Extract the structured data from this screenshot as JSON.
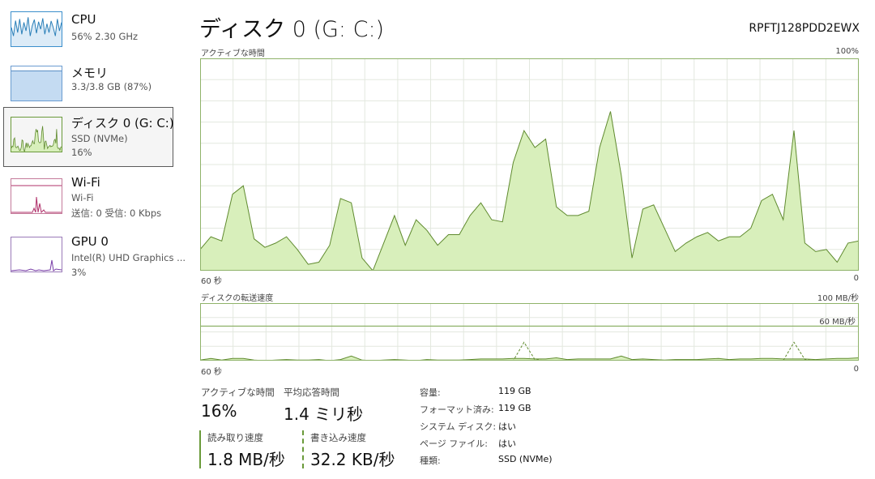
{
  "sidebar": {
    "items": [
      {
        "title": "CPU",
        "sub1": "56%  2.30 GHz",
        "sub2": ""
      },
      {
        "title": "メモリ",
        "sub1": "3.3/3.8 GB (87%)",
        "sub2": ""
      },
      {
        "title": "ディスク 0 (G: C:)",
        "sub1": "SSD (NVMe)",
        "sub2": "16%"
      },
      {
        "title": "Wi-Fi",
        "sub1": "Wi-Fi",
        "sub2": "送信: 0  受信: 0 Kbps"
      },
      {
        "title": "GPU 0",
        "sub1": "Intel(R) UHD Graphics ...",
        "sub2": "3%"
      }
    ]
  },
  "header": {
    "title": "ディスク 0 (G: C:)",
    "model": "RPFTJ128PDD2EWX"
  },
  "graph1": {
    "label": "アクティブな時間",
    "max_label": "100%",
    "left_axis": "60 秒",
    "right_axis": "0"
  },
  "graph2": {
    "label": "ディスクの転送速度",
    "max_label": "100 MB/秒",
    "line_label": "60 MB/秒",
    "left_axis": "60 秒",
    "right_axis": "0"
  },
  "stats": {
    "active_label": "アクティブな時間",
    "active_value": "16%",
    "resp_label": "平均応答時間",
    "resp_value": "1.4 ミリ秒",
    "read_label": "読み取り速度",
    "read_value": "1.8 MB/秒",
    "write_label": "書き込み速度",
    "write_value": "32.2 KB/秒"
  },
  "info": [
    {
      "key": "容量:",
      "value": "119 GB"
    },
    {
      "key": "フォーマット済み:",
      "value": "119 GB"
    },
    {
      "key": "システム ディスク:",
      "value": "はい"
    },
    {
      "key": "ページ ファイル:",
      "value": "はい"
    },
    {
      "key": "種類:",
      "value": "SSD (NVMe)"
    }
  ],
  "colors": {
    "disk_fill": "#d8efbb",
    "disk_line": "#5f8a2e",
    "cpu_line": "#2a7fb8",
    "mem_fill": "#c4dbf2",
    "wifi_line": "#b0306a",
    "gpu_line": "#7a3fa8",
    "grid": "#e3e8df"
  },
  "chart_data": {
    "active_time_percent": [
      10,
      16,
      14,
      36,
      40,
      15,
      11,
      13,
      16,
      10,
      3,
      4,
      12,
      34,
      32,
      6,
      0,
      13,
      26,
      12,
      24,
      19,
      12,
      17,
      17,
      26,
      32,
      24,
      23,
      51,
      66,
      58,
      62,
      30,
      26,
      26,
      28,
      58,
      75,
      45,
      6,
      29,
      31,
      20,
      9,
      13,
      16,
      18,
      14,
      16,
      16,
      20,
      33,
      36,
      24,
      66,
      13,
      9,
      10,
      4,
      13,
      14
    ],
    "transfer_read": [
      1,
      4,
      1,
      4,
      4,
      1,
      0,
      1,
      2,
      1,
      1,
      2,
      0,
      2,
      8,
      1,
      0,
      1,
      2,
      1,
      0,
      2,
      1,
      1,
      1,
      2,
      3,
      3,
      3,
      4,
      4,
      3,
      3,
      5,
      2,
      3,
      3,
      3,
      3,
      8,
      2,
      3,
      2,
      1,
      2,
      2,
      2,
      3,
      4,
      2,
      3,
      3,
      4,
      4,
      3,
      3,
      3,
      2,
      3,
      4,
      4,
      5
    ],
    "transfer_write": [
      0,
      0,
      0,
      0,
      0,
      0,
      0,
      0,
      0,
      0,
      0,
      0,
      0,
      0,
      0,
      0,
      0,
      0,
      0,
      0,
      0,
      0,
      0,
      0,
      0,
      0,
      0,
      0,
      0,
      0,
      32,
      2,
      0,
      0,
      0,
      0,
      0,
      0,
      0,
      0,
      0,
      0,
      0,
      0,
      0,
      0,
      0,
      0,
      0,
      0,
      0,
      0,
      0,
      0,
      0,
      32,
      2,
      0,
      0,
      0,
      0,
      0
    ],
    "transfer_ymax": 100,
    "transfer_line": 60
  }
}
